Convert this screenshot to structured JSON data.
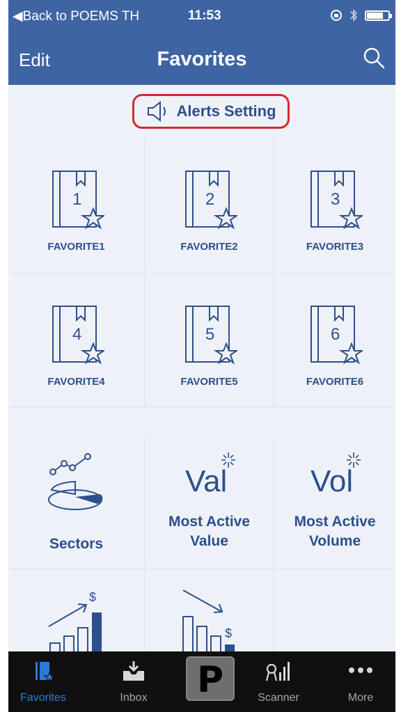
{
  "status_bar": {
    "back_label": "◀Back to POEMS TH",
    "time": "11:53",
    "battery_level": 0.75
  },
  "nav": {
    "edit_label": "Edit",
    "title": "Favorites",
    "search_icon": "search-icon"
  },
  "alerts": {
    "label": "Alerts Setting",
    "icon": "speaker-icon",
    "highlight_color": "#d9272e"
  },
  "favorites": [
    {
      "number": "1",
      "label": "FAVORITE1"
    },
    {
      "number": "2",
      "label": "FAVORITE2"
    },
    {
      "number": "3",
      "label": "FAVORITE3"
    },
    {
      "number": "4",
      "label": "FAVORITE4"
    },
    {
      "number": "5",
      "label": "FAVORITE5"
    },
    {
      "number": "6",
      "label": "FAVORITE6"
    }
  ],
  "market": {
    "sectors": {
      "label": "Sectors",
      "icon": "sectors-chart-icon"
    },
    "most_active_value": {
      "line1": "Most Active",
      "line2": "Value",
      "icon_text": "Val"
    },
    "most_active_volume": {
      "line1": "Most Active",
      "line2": "Volume",
      "icon_text": "Vol"
    },
    "top_gainers": {
      "icon": "rising-bars-dollar-icon",
      "icon_text": "$"
    },
    "top_losers": {
      "icon": "falling-bars-dollar-icon",
      "icon_text": "$"
    }
  },
  "tabbar": {
    "favorites": "Favorites",
    "inbox": "Inbox",
    "poems": "P",
    "scanner": "Scanner",
    "more": "More"
  },
  "colors": {
    "nav_blue": "#3e64a3",
    "icon_blue": "#2d4f8c",
    "active_tab": "#2d79d6"
  }
}
